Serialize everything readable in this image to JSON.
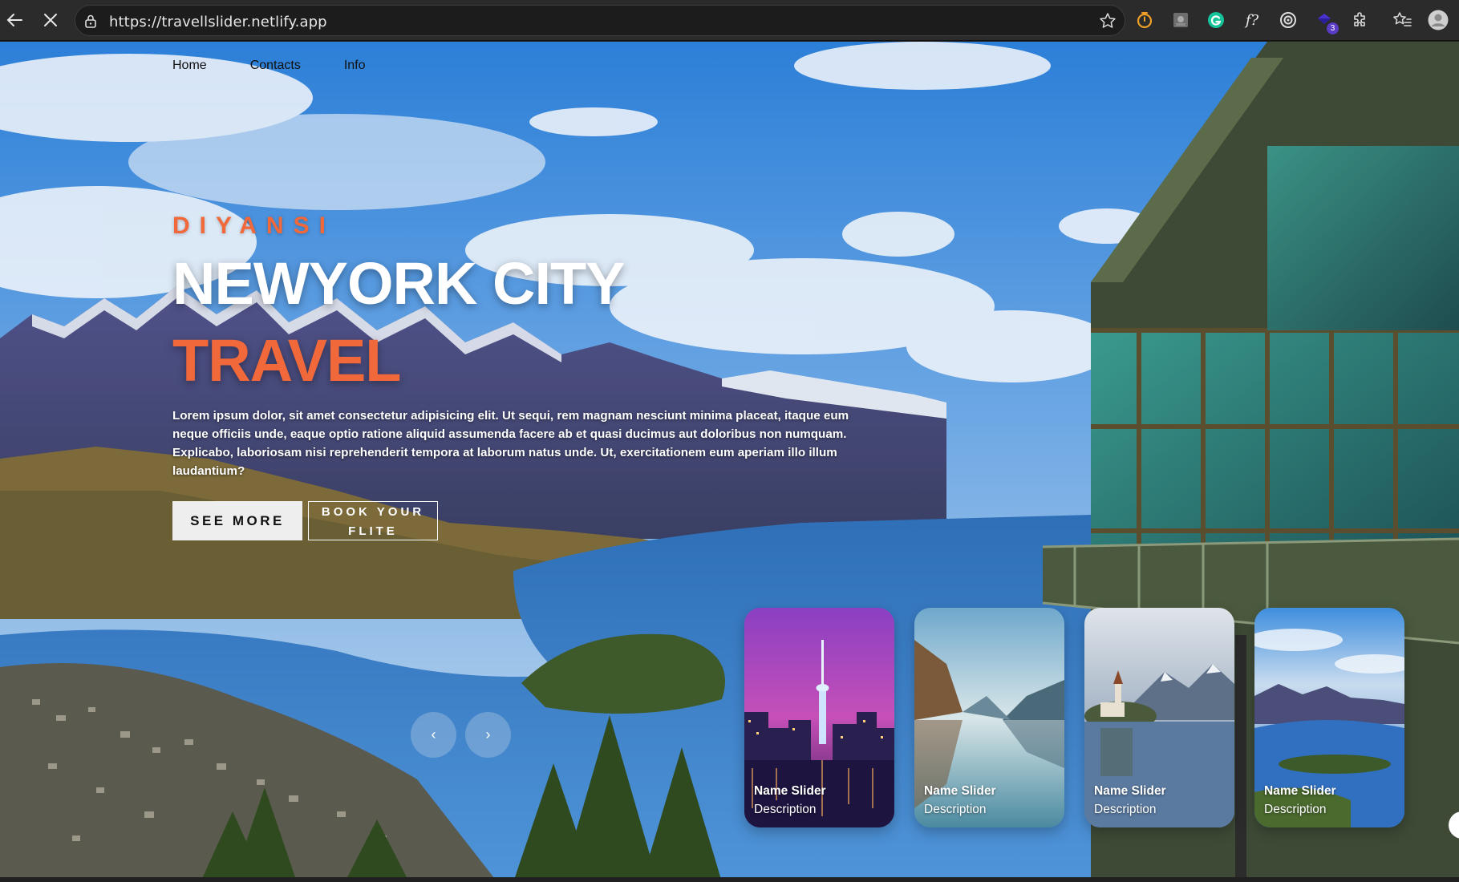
{
  "browser": {
    "url": "https://travellslider.netlify.app",
    "extensions": [
      {
        "icon": "timer-extension-icon"
      },
      {
        "icon": "image-extension-icon"
      },
      {
        "icon": "grammarly-icon",
        "letter": "G"
      },
      {
        "icon": "font-finder-icon",
        "letter": "f?"
      },
      {
        "icon": "target-extension-icon"
      },
      {
        "icon": "purple-extension-icon",
        "badge": "3"
      },
      {
        "icon": "puzzle-icon"
      },
      {
        "icon": "favorites-icon"
      },
      {
        "icon": "profile-avatar-icon"
      }
    ]
  },
  "nav": {
    "home": "Home",
    "contacts": "Contacts",
    "info": "Info"
  },
  "hero": {
    "brand": "DIYANSI",
    "title": "NEWYORK CITY",
    "topic": "TRAVEL",
    "description": "Lorem ipsum dolor, sit amet consectetur adipisicing elit. Ut sequi, rem magnam nesciunt minima placeat, itaque eum neque officiis unde, eaque optio ratione aliquid assumenda facere ab et quasi ducimus aut doloribus non numquam. Explicabo, laboriosam nisi reprehenderit tempora at laborum natus unde. Ut, exercitationem eum aperiam illo illum laudantium?",
    "see_more": "SEE MORE",
    "book_line1": "BOOK YOUR",
    "book_line2": "FLITE"
  },
  "slider": {
    "prev": "‹",
    "next": "›",
    "thumbnails": [
      {
        "title": "Name Slider",
        "description": "Description",
        "scene": "city-tower-night"
      },
      {
        "title": "Name Slider",
        "description": "Description",
        "scene": "fjord-reflection"
      },
      {
        "title": "Name Slider",
        "description": "Description",
        "scene": "lake-island-church"
      },
      {
        "title": "Name Slider",
        "description": "Description",
        "scene": "mountain-lake-valley"
      }
    ]
  },
  "colors": {
    "accent": "#f1683a",
    "sky": "#3e8fe0",
    "lake": "#2f78c4"
  }
}
